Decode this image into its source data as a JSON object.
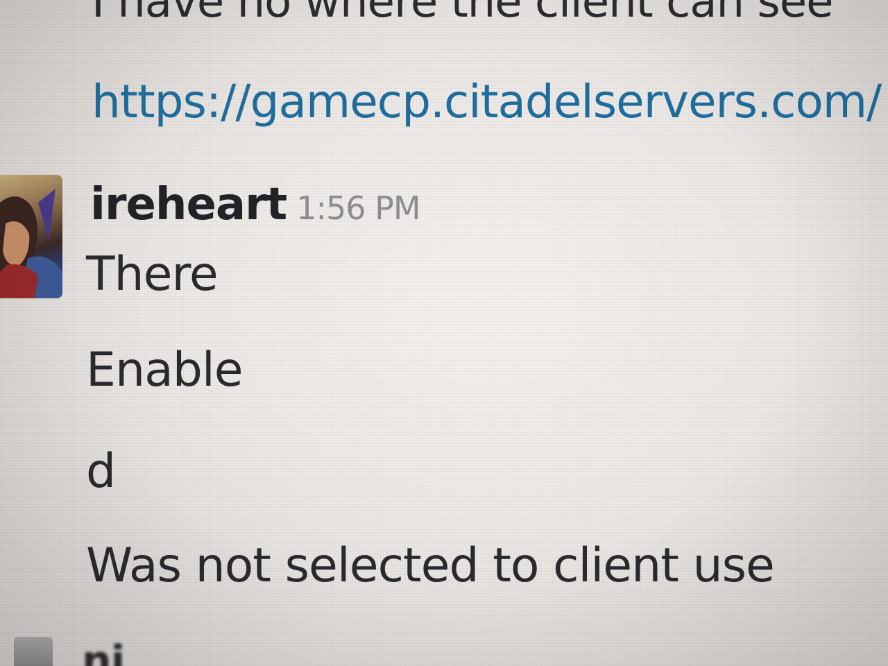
{
  "previous_message": {
    "text": "I have no where the client can see",
    "link": "https://gamecp.citadelservers.com/"
  },
  "message": {
    "author": "ireheart",
    "timestamp": "1:56 PM",
    "lines": [
      "There",
      "Enable",
      "d",
      "Was not selected to client use"
    ]
  },
  "next_message": {
    "author_partial": "ni"
  },
  "colors": {
    "link": "#1f6e9f",
    "timestamp": "#8e8d91",
    "text": "#2a2a2e",
    "background": "#ece8e5"
  }
}
